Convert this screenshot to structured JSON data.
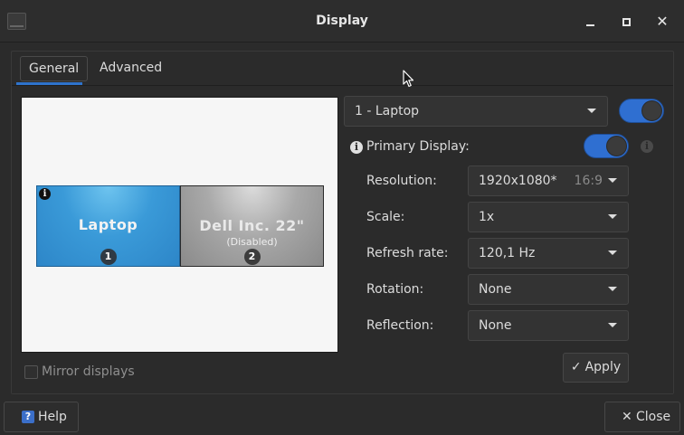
{
  "window": {
    "title": "Display"
  },
  "tabs": [
    {
      "label": "General"
    },
    {
      "label": "Advanced"
    }
  ],
  "preview": {
    "monitors": [
      {
        "name": "Laptop",
        "sub": "",
        "number": "1"
      },
      {
        "name": "Dell Inc. 22\"",
        "sub": "(Disabled)",
        "number": "2"
      }
    ],
    "info_glyph": "i"
  },
  "mirror_label": "Mirror displays",
  "monitor_select": {
    "value": "1 - Laptop"
  },
  "primary": {
    "label": "Primary Display:",
    "info_glyph": "i"
  },
  "settings": [
    {
      "label": "Resolution:",
      "value": "1920x1080*",
      "hint": "16:9"
    },
    {
      "label": "Scale:",
      "value": "1x",
      "hint": ""
    },
    {
      "label": "Refresh rate:",
      "value": "120,1 Hz",
      "hint": ""
    },
    {
      "label": "Rotation:",
      "value": "None",
      "hint": ""
    },
    {
      "label": "Reflection:",
      "value": "None",
      "hint": ""
    }
  ],
  "buttons": {
    "apply": "Apply",
    "apply_glyph": "✓",
    "help": "Help",
    "help_glyph": "?",
    "close": "Close",
    "close_glyph": "✕"
  },
  "colors": {
    "accent": "#2f6fd1",
    "window_bg": "#2b2b2b"
  },
  "icons": [
    "app-icon",
    "minimize-icon",
    "maximize-icon",
    "close-icon",
    "info-icon",
    "chevron-down-icon",
    "checkmark-icon",
    "help-icon",
    "mouse-cursor-icon"
  ]
}
